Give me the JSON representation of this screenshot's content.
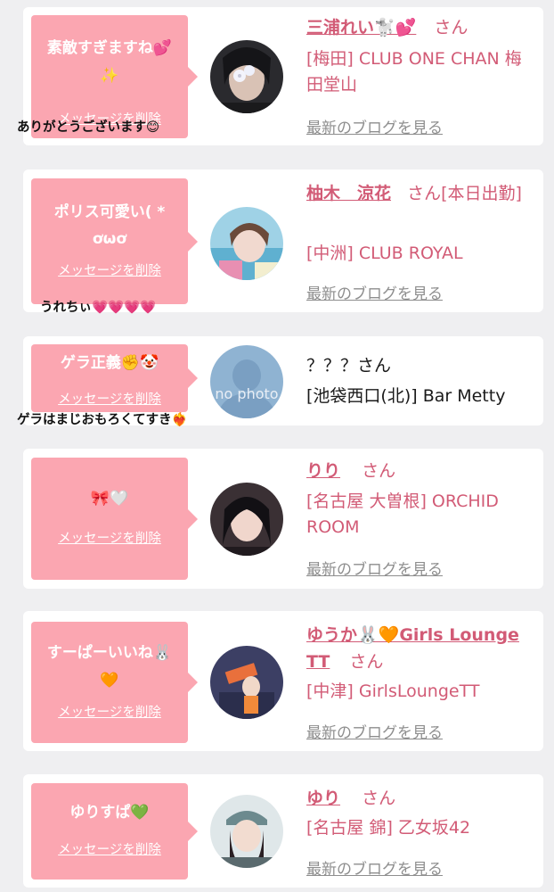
{
  "delete_label": "メッセージを削除",
  "blog_label": "最新のブログを見る",
  "san_suffix": "さん",
  "entries": [
    {
      "message": "素敵すぎますね💕✨",
      "reply": "ありがとうございます😊",
      "cast_name": "三浦れい🐩💕",
      "shop": "[梅田] CLUB ONE CHAN 梅田堂山",
      "avatar": "cast-photo"
    },
    {
      "message": "ポリス可愛い( * ơωơ",
      "reply": "うれちぃ💗💗💗💗",
      "cast_name": "柚木　涼花",
      "shop": "[中洲] CLUB ROYAL",
      "name_suffix": "さん[本日出勤]",
      "avatar": "cast-photo"
    },
    {
      "message": "ゲラ正義✊🤡",
      "reply": "ゲラはまじおもろくてすき❤️‍🔥",
      "cast_name": "？？？さん",
      "shop": "[池袋西口(北)] Bar Metty",
      "avatar": "no photo"
    },
    {
      "message": "🎀🤍",
      "cast_name": "りり",
      "shop": "[名古屋 大曽根] ORCHID ROOM",
      "avatar": "cast-photo"
    },
    {
      "message": "すーぱーいいね🐰🧡",
      "cast_name": "ゆうか🐰🧡Girls Lounge TT",
      "shop": "[中津] GirlsLoungeTT",
      "avatar": "cast-photo"
    },
    {
      "message": "ゆりすぱ💚",
      "cast_name": "ゆり",
      "shop": "[名古屋 錦] 乙女坂42",
      "avatar": "cast-photo"
    }
  ],
  "colors": {
    "bubble": "#fba6b1",
    "accent": "#d25b76",
    "background": "#efeff1"
  }
}
